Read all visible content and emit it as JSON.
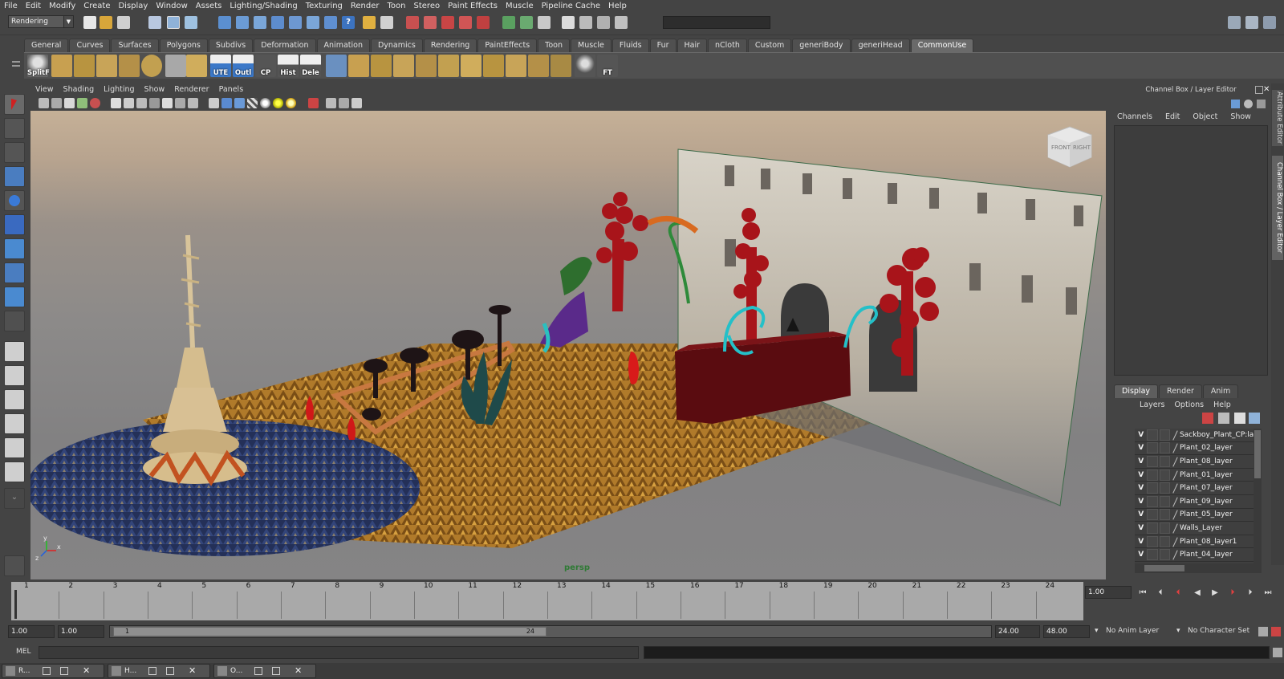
{
  "menubar": [
    "File",
    "Edit",
    "Modify",
    "Create",
    "Display",
    "Window",
    "Assets",
    "Lighting/Shading",
    "Texturing",
    "Render",
    "Toon",
    "Stereo",
    "Paint Effects",
    "Muscle",
    "Pipeline Cache",
    "Help"
  ],
  "status": {
    "menu_set": "Rendering"
  },
  "shelf": {
    "tabs": [
      "General",
      "Curves",
      "Surfaces",
      "Polygons",
      "Subdivs",
      "Deformation",
      "Animation",
      "Dynamics",
      "Rendering",
      "PaintEffects",
      "Toon",
      "Muscle",
      "Fluids",
      "Fur",
      "Hair",
      "nCloth",
      "Custom",
      "generiBody",
      "generiHead",
      "CommonUse"
    ],
    "active_tab": "CommonUse",
    "button_labels": {
      "splitf": "SplitF",
      "ute": "UTE",
      "outl": "Outl",
      "cp": "CP",
      "hist": "Hist",
      "dele": "Dele",
      "ft": "FT"
    }
  },
  "viewport": {
    "menu": [
      "View",
      "Shading",
      "Lighting",
      "Show",
      "Renderer",
      "Panels"
    ],
    "camera": "persp",
    "viewcube": {
      "front": "FRONT",
      "right": "RIGHT"
    },
    "axis": {
      "x": "x",
      "y": "y",
      "z": "z"
    }
  },
  "channel_box": {
    "title": "Channel Box / Layer Editor",
    "menu": [
      "Channels",
      "Edit",
      "Object",
      "Show"
    ]
  },
  "layer_editor": {
    "tabs": [
      "Display",
      "Render",
      "Anim"
    ],
    "active_tab": "Display",
    "menu": [
      "Layers",
      "Options",
      "Help"
    ],
    "layers": [
      {
        "v": "V",
        "name": "Sackboy_Plant_CP:layer"
      },
      {
        "v": "V",
        "name": "Plant_02_layer"
      },
      {
        "v": "V",
        "name": "Plant_08_layer"
      },
      {
        "v": "V",
        "name": "Plant_01_layer"
      },
      {
        "v": "V",
        "name": "Plant_07_layer"
      },
      {
        "v": "V",
        "name": "Plant_09_layer"
      },
      {
        "v": "V",
        "name": "Plant_05_layer"
      },
      {
        "v": "V",
        "name": "Walls_Layer"
      },
      {
        "v": "V",
        "name": "Plant_08_layer1"
      },
      {
        "v": "V",
        "name": "Plant_04_layer"
      }
    ]
  },
  "side_tabs": [
    "Attribute Editor",
    "Channel Box / Layer Editor"
  ],
  "time_slider": {
    "frames": [
      "1",
      "2",
      "3",
      "4",
      "5",
      "6",
      "7",
      "8",
      "9",
      "10",
      "11",
      "12",
      "13",
      "14",
      "15",
      "16",
      "17",
      "18",
      "19",
      "20",
      "21",
      "22",
      "23",
      "24"
    ],
    "current_frame": "1.00"
  },
  "range": {
    "start": "1.00",
    "inner_start": "1.00",
    "bar_start": "1",
    "bar_end": "24",
    "end": "24.00",
    "outer_end": "48.00",
    "anim_layer": "No Anim Layer",
    "character_set": "No Character Set"
  },
  "command_line": {
    "label": "MEL"
  },
  "taskbar": [
    {
      "label": "R..."
    },
    {
      "label": "H..."
    },
    {
      "label": "O..."
    }
  ],
  "colors": {
    "accent": "#6a6a6a",
    "ui_bg": "#444444",
    "timeline": "#a9a9a9",
    "camera_label": "#2e7a34"
  }
}
